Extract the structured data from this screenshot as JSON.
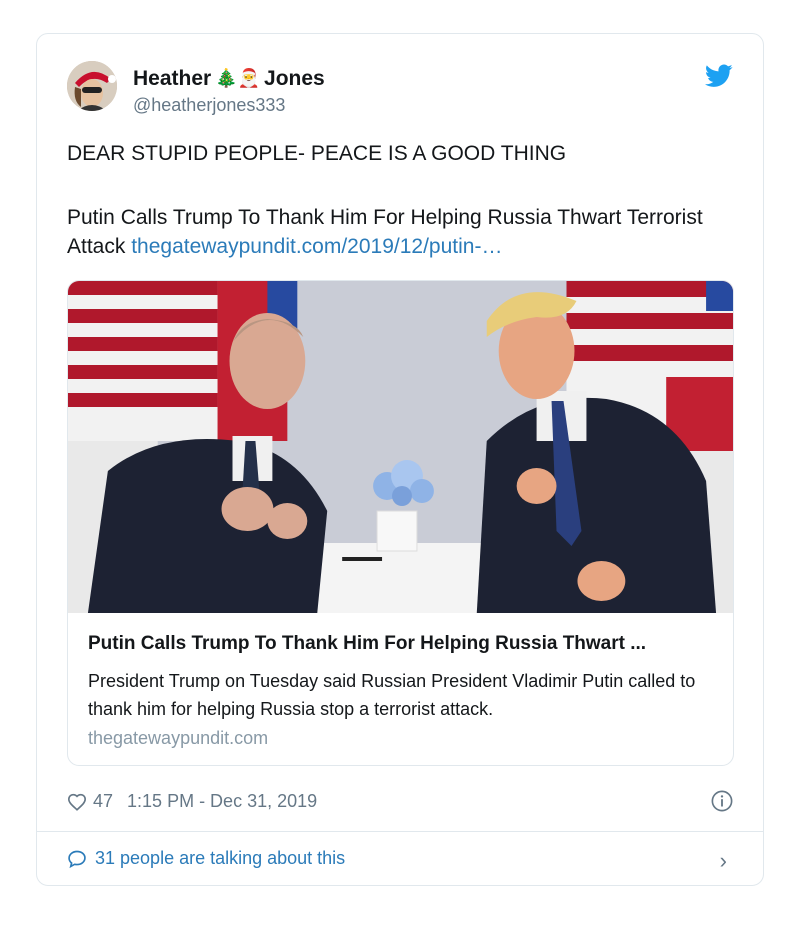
{
  "tweet": {
    "author": {
      "name_first": "Heather",
      "name_emojis": "🎄🎅",
      "name_last": "Jones",
      "handle": "@heatherjones333"
    },
    "brand_color": "#1da1f2",
    "body_line1": "DEAR STUPID PEOPLE- PEACE IS A GOOD THING",
    "body_line2_text": "Putin Calls Trump To Thank Him For Helping Russia Thwart Terrorist Attack",
    "body_link": "thegatewaypundit.com/2019/12/putin-…",
    "link_color": "#2b7bb9",
    "embed": {
      "title": "Putin Calls Trump To Thank Him For Helping Russia Thwart ...",
      "description": "President Trump on Tuesday said Russian President Vladimir Putin called to thank him for helping Russia stop a terrorist attack.",
      "domain": "thegatewaypundit.com"
    },
    "likes": "47",
    "timestamp": "1:15 PM - Dec 31, 2019",
    "talking": "31 people are talking about this"
  }
}
